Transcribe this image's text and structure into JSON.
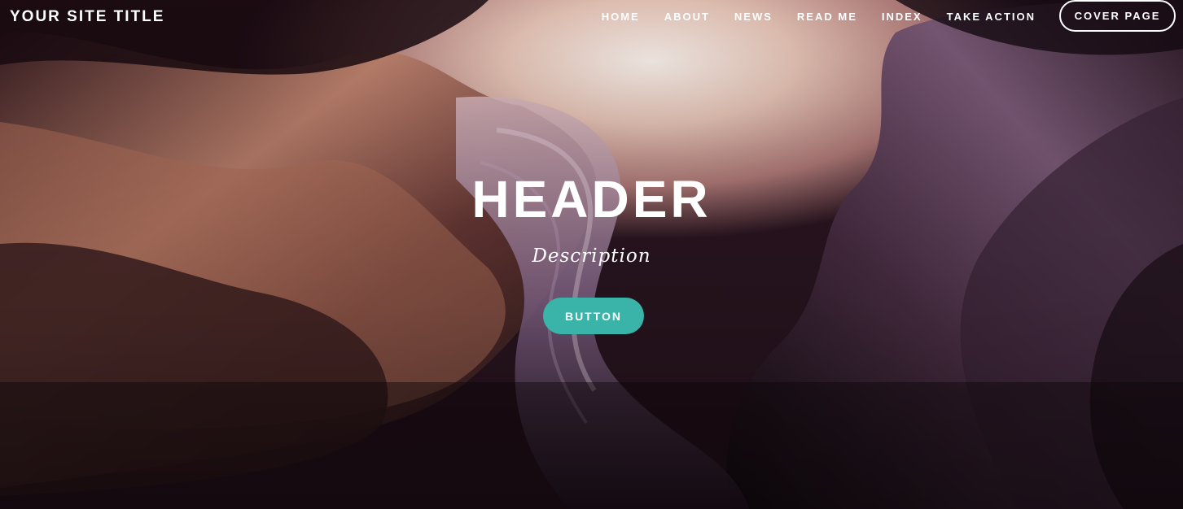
{
  "header": {
    "site_title": "YOUR SITE TITLE",
    "nav": [
      {
        "label": "HOME"
      },
      {
        "label": "ABOUT"
      },
      {
        "label": "NEWS"
      },
      {
        "label": "READ ME"
      },
      {
        "label": "INDEX"
      },
      {
        "label": "TAKE ACTION"
      }
    ],
    "cover_button": "COVER PAGE"
  },
  "hero": {
    "title": "HEADER",
    "description": "Description",
    "button_label": "BUTTON",
    "button_color": "#3ab3a8",
    "background": "canyon-photo"
  }
}
